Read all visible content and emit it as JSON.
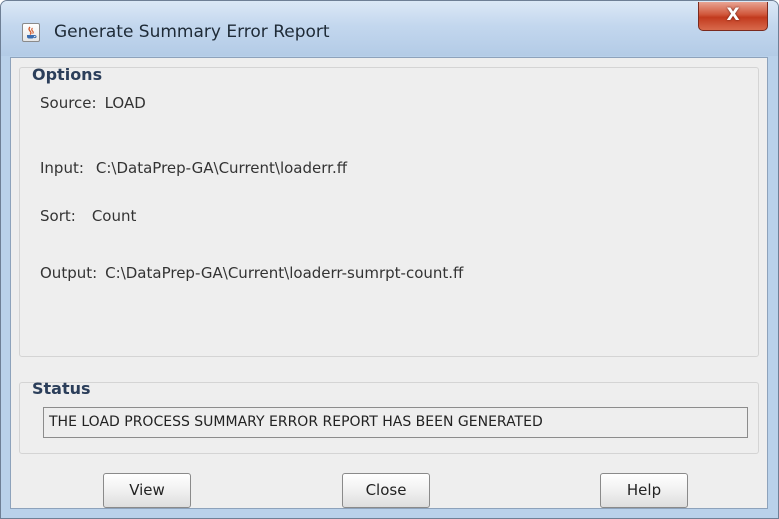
{
  "window": {
    "title": "Generate Summary Error Report",
    "close_label": "X"
  },
  "options": {
    "heading": "Options",
    "source_label": "Source:",
    "source_value": "LOAD",
    "input_label": "Input:",
    "input_value": "C:\\DataPrep-GA\\Current\\loaderr.ff",
    "sort_label": "Sort:",
    "sort_value": "Count",
    "output_label": "Output:",
    "output_value": "C:\\DataPrep-GA\\Current\\loaderr-sumrpt-count.ff"
  },
  "status": {
    "heading": "Status",
    "message": "THE LOAD PROCESS SUMMARY ERROR REPORT HAS BEEN GENERATED"
  },
  "buttons": {
    "view": "View",
    "close": "Close",
    "help": "Help"
  },
  "icons": {
    "app": "java-coffee-cup-icon",
    "close": "close-icon"
  },
  "colors": {
    "title_bar": "#c3d7ee",
    "close_button": "#c94a2e",
    "client_background": "#eeeeee",
    "group_heading": "#2b3e5a"
  }
}
